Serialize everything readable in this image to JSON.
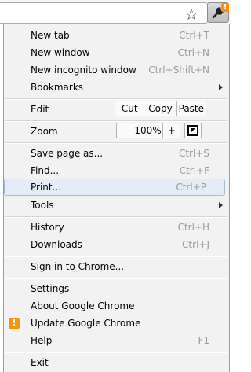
{
  "menu": {
    "new_tab": {
      "label": "New tab",
      "shortcut": "Ctrl+T"
    },
    "new_window": {
      "label": "New window",
      "shortcut": "Ctrl+N"
    },
    "new_incognito": {
      "label": "New incognito window",
      "shortcut": "Ctrl+Shift+N"
    },
    "bookmarks": {
      "label": "Bookmarks"
    },
    "edit": {
      "label": "Edit",
      "cut": "Cut",
      "copy": "Copy",
      "paste": "Paste"
    },
    "zoom": {
      "label": "Zoom",
      "minus": "-",
      "level": "100%",
      "plus": "+"
    },
    "save_page": {
      "label": "Save page as...",
      "shortcut": "Ctrl+S"
    },
    "find": {
      "label": "Find...",
      "shortcut": "Ctrl+F"
    },
    "print": {
      "label": "Print...",
      "shortcut": "Ctrl+P"
    },
    "tools": {
      "label": "Tools"
    },
    "history": {
      "label": "History",
      "shortcut": "Ctrl+H"
    },
    "downloads": {
      "label": "Downloads",
      "shortcut": "Ctrl+J"
    },
    "sign_in": {
      "label": "Sign in to Chrome..."
    },
    "settings": {
      "label": "Settings"
    },
    "about": {
      "label": "About Google Chrome"
    },
    "update": {
      "label": "Update Google Chrome",
      "icon_text": "!"
    },
    "help": {
      "label": "Help",
      "shortcut": "F1"
    },
    "exit": {
      "label": "Exit"
    }
  },
  "toolbar": {
    "badge_text": "!",
    "star_icon": "star-icon",
    "wrench_icon": "wrench-icon"
  },
  "colors": {
    "highlight_bg": "#e6ecf6",
    "highlight_border": "#a8bbd6",
    "badge": "#f29414",
    "shortcut_text": "#9a9a9a"
  }
}
